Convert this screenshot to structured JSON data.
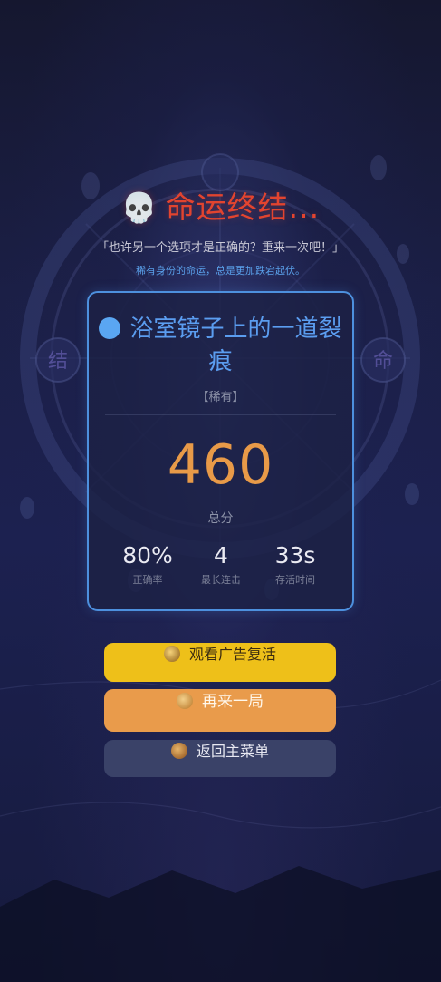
{
  "result": {
    "title": "命运终结...",
    "title_icon": "skull-icon",
    "subtitle": "「也许另一个选项才是正确的？重来一次吧！」",
    "hint": "稀有身份的命运，总是更加跌宕起伏。"
  },
  "card": {
    "dot_color": "#5aa6f2",
    "title": "浴室镜子上的一道裂痕",
    "rarity": "【稀有】",
    "score": "460",
    "score_label": "总分",
    "stats": [
      {
        "value": "80%",
        "label": "正确率"
      },
      {
        "value": "4",
        "label": "最长连击"
      },
      {
        "value": "33s",
        "label": "存活时间"
      }
    ]
  },
  "buttons": {
    "watch_ad": "观看广告复活",
    "retry": "再来一局",
    "main_menu": "返回主菜单"
  },
  "background": {
    "left_rune": "结",
    "right_rune": "命"
  },
  "colors": {
    "title": "#e2442f",
    "card_border": "#4d90de",
    "score": "#e89a48",
    "ad_button": "#eec019",
    "retry_button": "#e99b4b",
    "menu_button": "#3a4268"
  }
}
